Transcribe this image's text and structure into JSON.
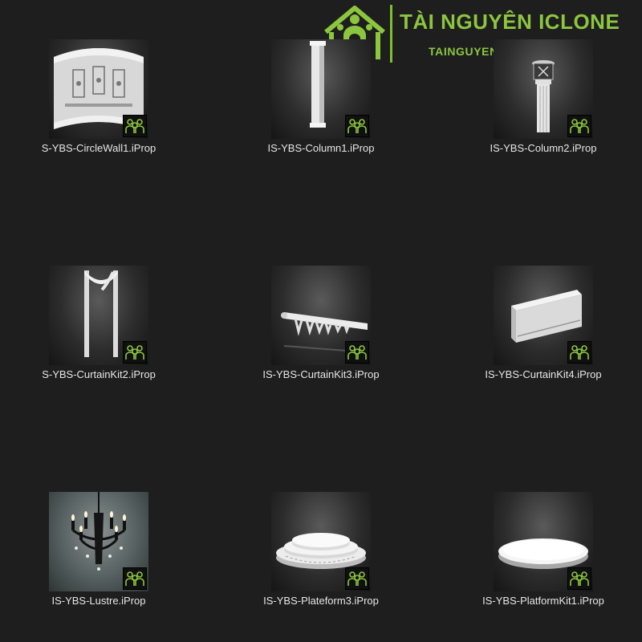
{
  "watermark": {
    "title": "TÀI NGUYÊN ICLONE",
    "subtitle": "TAINGUYENICLONE.COM",
    "icon": "house-people-logo-icon",
    "color": "#8cc63f"
  },
  "badge_icon": "iprop-people-badge-icon",
  "items": [
    {
      "label": "S-YBS-CircleWall1.iProp",
      "thumb": "circle-wall"
    },
    {
      "label": "IS-YBS-Column1.iProp",
      "thumb": "column-plain"
    },
    {
      "label": "IS-YBS-Column2.iProp",
      "thumb": "column-ornate"
    },
    {
      "label": "S-YBS-CurtainKit2.iProp",
      "thumb": "curtain-arch"
    },
    {
      "label": "IS-YBS-CurtainKit3.iProp",
      "thumb": "curtain-rail"
    },
    {
      "label": "IS-YBS-CurtainKit4.iProp",
      "thumb": "curtain-box"
    },
    {
      "label": "IS-YBS-Lustre.iProp",
      "thumb": "chandelier"
    },
    {
      "label": "IS-YBS-Plateform3.iProp",
      "thumb": "platform-tiered"
    },
    {
      "label": "IS-YBS-PlatformKit1.iProp",
      "thumb": "platform-disc"
    }
  ]
}
